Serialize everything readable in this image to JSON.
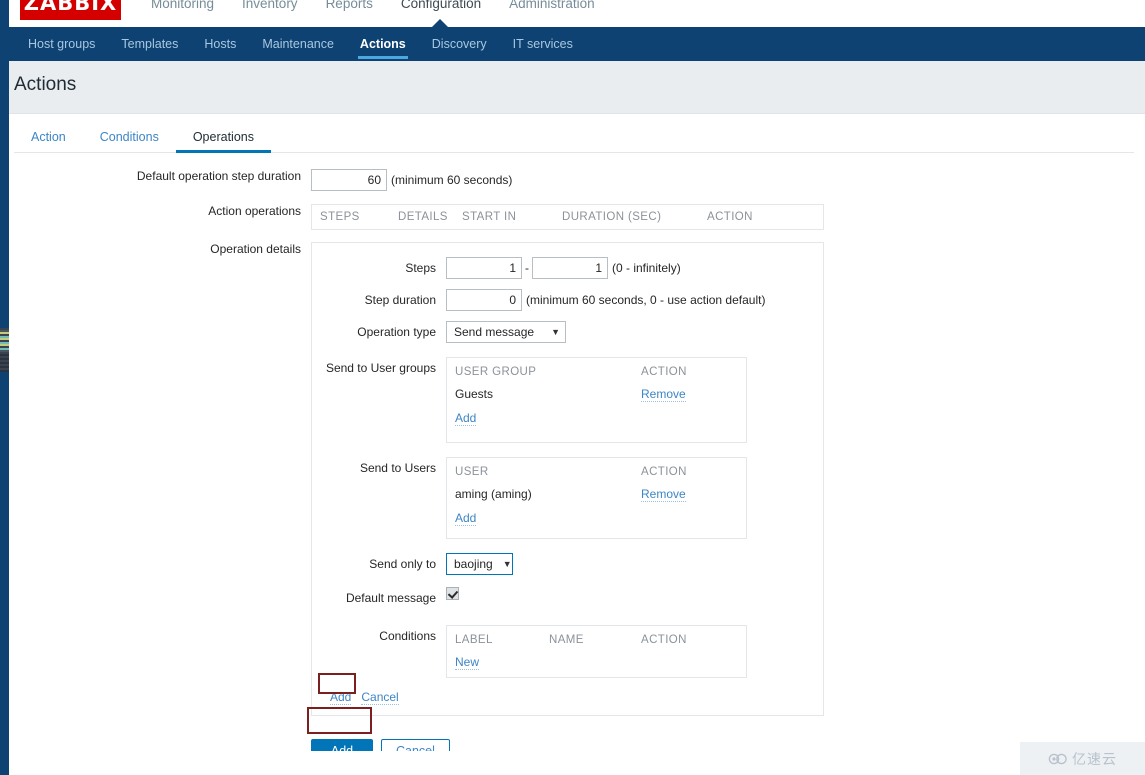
{
  "app": {
    "logo": "ZABBIX",
    "main_menu": [
      {
        "label": "Monitoring",
        "active": false
      },
      {
        "label": "Inventory",
        "active": false
      },
      {
        "label": "Reports",
        "active": false
      },
      {
        "label": "Configuration",
        "active": true
      },
      {
        "label": "Administration",
        "active": false
      }
    ],
    "sub_menu": [
      {
        "label": "Host groups",
        "active": false
      },
      {
        "label": "Templates",
        "active": false
      },
      {
        "label": "Hosts",
        "active": false
      },
      {
        "label": "Maintenance",
        "active": false
      },
      {
        "label": "Actions",
        "active": true
      },
      {
        "label": "Discovery",
        "active": false
      },
      {
        "label": "IT services",
        "active": false
      }
    ]
  },
  "page": {
    "title": "Actions"
  },
  "tabs": [
    {
      "label": "Action",
      "active": false
    },
    {
      "label": "Conditions",
      "active": false
    },
    {
      "label": "Operations",
      "active": true
    }
  ],
  "form": {
    "default_step_duration": {
      "label": "Default operation step duration",
      "value": "60",
      "hint": "(minimum 60 seconds)"
    },
    "action_operations": {
      "label": "Action operations",
      "columns": [
        "STEPS",
        "DETAILS",
        "START IN",
        "DURATION (SEC)",
        "ACTION"
      ],
      "rows": []
    },
    "operation_details": {
      "label": "Operation details",
      "steps": {
        "label": "Steps",
        "from": "1",
        "separator": "-",
        "to": "1",
        "hint": "(0 - infinitely)"
      },
      "step_duration": {
        "label": "Step duration",
        "value": "0",
        "hint": "(minimum 60 seconds, 0 - use action default)"
      },
      "operation_type": {
        "label": "Operation type",
        "value": "Send message",
        "caret": "chevron-down-icon"
      },
      "send_to_user_groups": {
        "label": "Send to User groups",
        "columns": [
          "USER GROUP",
          "ACTION"
        ],
        "rows": [
          {
            "name": "Guests",
            "action": "Remove"
          }
        ],
        "add_label": "Add"
      },
      "send_to_users": {
        "label": "Send to Users",
        "columns": [
          "USER",
          "ACTION"
        ],
        "rows": [
          {
            "name": "aming (aming)",
            "action": "Remove"
          }
        ],
        "add_label": "Add"
      },
      "send_only_to": {
        "label": "Send only to",
        "value": "baojing",
        "caret": "chevron-down-icon"
      },
      "default_message": {
        "label": "Default message",
        "checked": true
      },
      "conditions": {
        "label": "Conditions",
        "columns": [
          "LABEL",
          "NAME",
          "ACTION"
        ],
        "rows": [],
        "new_label": "New"
      },
      "footer": {
        "add_label": "Add",
        "cancel_label": "Cancel"
      }
    },
    "footer_buttons": {
      "add_label": "Add",
      "cancel_label": "Cancel"
    }
  },
  "watermark": {
    "text": "亿速云",
    "icon": "cloud-icon"
  },
  "colors": {
    "brand_red": "#d40000",
    "nav_blue": "#0e4272",
    "accent_blue": "#0275b8",
    "link_blue": "#3d85c6",
    "annotation_red": "#7b1f1f"
  }
}
